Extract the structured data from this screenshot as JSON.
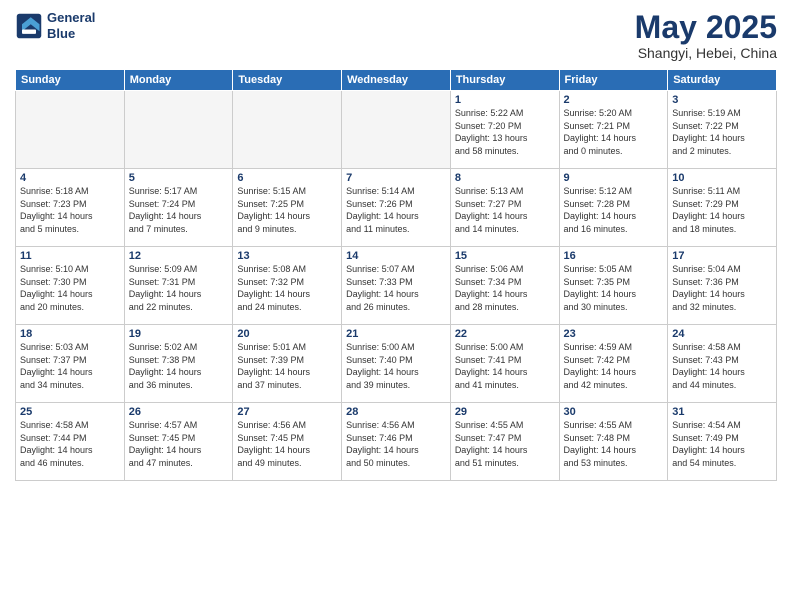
{
  "header": {
    "logo_line1": "General",
    "logo_line2": "Blue",
    "month": "May 2025",
    "location": "Shangyi, Hebei, China"
  },
  "weekdays": [
    "Sunday",
    "Monday",
    "Tuesday",
    "Wednesday",
    "Thursday",
    "Friday",
    "Saturday"
  ],
  "weeks": [
    [
      {
        "day": "",
        "info": ""
      },
      {
        "day": "",
        "info": ""
      },
      {
        "day": "",
        "info": ""
      },
      {
        "day": "",
        "info": ""
      },
      {
        "day": "1",
        "info": "Sunrise: 5:22 AM\nSunset: 7:20 PM\nDaylight: 13 hours\nand 58 minutes."
      },
      {
        "day": "2",
        "info": "Sunrise: 5:20 AM\nSunset: 7:21 PM\nDaylight: 14 hours\nand 0 minutes."
      },
      {
        "day": "3",
        "info": "Sunrise: 5:19 AM\nSunset: 7:22 PM\nDaylight: 14 hours\nand 2 minutes."
      }
    ],
    [
      {
        "day": "4",
        "info": "Sunrise: 5:18 AM\nSunset: 7:23 PM\nDaylight: 14 hours\nand 5 minutes."
      },
      {
        "day": "5",
        "info": "Sunrise: 5:17 AM\nSunset: 7:24 PM\nDaylight: 14 hours\nand 7 minutes."
      },
      {
        "day": "6",
        "info": "Sunrise: 5:15 AM\nSunset: 7:25 PM\nDaylight: 14 hours\nand 9 minutes."
      },
      {
        "day": "7",
        "info": "Sunrise: 5:14 AM\nSunset: 7:26 PM\nDaylight: 14 hours\nand 11 minutes."
      },
      {
        "day": "8",
        "info": "Sunrise: 5:13 AM\nSunset: 7:27 PM\nDaylight: 14 hours\nand 14 minutes."
      },
      {
        "day": "9",
        "info": "Sunrise: 5:12 AM\nSunset: 7:28 PM\nDaylight: 14 hours\nand 16 minutes."
      },
      {
        "day": "10",
        "info": "Sunrise: 5:11 AM\nSunset: 7:29 PM\nDaylight: 14 hours\nand 18 minutes."
      }
    ],
    [
      {
        "day": "11",
        "info": "Sunrise: 5:10 AM\nSunset: 7:30 PM\nDaylight: 14 hours\nand 20 minutes."
      },
      {
        "day": "12",
        "info": "Sunrise: 5:09 AM\nSunset: 7:31 PM\nDaylight: 14 hours\nand 22 minutes."
      },
      {
        "day": "13",
        "info": "Sunrise: 5:08 AM\nSunset: 7:32 PM\nDaylight: 14 hours\nand 24 minutes."
      },
      {
        "day": "14",
        "info": "Sunrise: 5:07 AM\nSunset: 7:33 PM\nDaylight: 14 hours\nand 26 minutes."
      },
      {
        "day": "15",
        "info": "Sunrise: 5:06 AM\nSunset: 7:34 PM\nDaylight: 14 hours\nand 28 minutes."
      },
      {
        "day": "16",
        "info": "Sunrise: 5:05 AM\nSunset: 7:35 PM\nDaylight: 14 hours\nand 30 minutes."
      },
      {
        "day": "17",
        "info": "Sunrise: 5:04 AM\nSunset: 7:36 PM\nDaylight: 14 hours\nand 32 minutes."
      }
    ],
    [
      {
        "day": "18",
        "info": "Sunrise: 5:03 AM\nSunset: 7:37 PM\nDaylight: 14 hours\nand 34 minutes."
      },
      {
        "day": "19",
        "info": "Sunrise: 5:02 AM\nSunset: 7:38 PM\nDaylight: 14 hours\nand 36 minutes."
      },
      {
        "day": "20",
        "info": "Sunrise: 5:01 AM\nSunset: 7:39 PM\nDaylight: 14 hours\nand 37 minutes."
      },
      {
        "day": "21",
        "info": "Sunrise: 5:00 AM\nSunset: 7:40 PM\nDaylight: 14 hours\nand 39 minutes."
      },
      {
        "day": "22",
        "info": "Sunrise: 5:00 AM\nSunset: 7:41 PM\nDaylight: 14 hours\nand 41 minutes."
      },
      {
        "day": "23",
        "info": "Sunrise: 4:59 AM\nSunset: 7:42 PM\nDaylight: 14 hours\nand 42 minutes."
      },
      {
        "day": "24",
        "info": "Sunrise: 4:58 AM\nSunset: 7:43 PM\nDaylight: 14 hours\nand 44 minutes."
      }
    ],
    [
      {
        "day": "25",
        "info": "Sunrise: 4:58 AM\nSunset: 7:44 PM\nDaylight: 14 hours\nand 46 minutes."
      },
      {
        "day": "26",
        "info": "Sunrise: 4:57 AM\nSunset: 7:45 PM\nDaylight: 14 hours\nand 47 minutes."
      },
      {
        "day": "27",
        "info": "Sunrise: 4:56 AM\nSunset: 7:45 PM\nDaylight: 14 hours\nand 49 minutes."
      },
      {
        "day": "28",
        "info": "Sunrise: 4:56 AM\nSunset: 7:46 PM\nDaylight: 14 hours\nand 50 minutes."
      },
      {
        "day": "29",
        "info": "Sunrise: 4:55 AM\nSunset: 7:47 PM\nDaylight: 14 hours\nand 51 minutes."
      },
      {
        "day": "30",
        "info": "Sunrise: 4:55 AM\nSunset: 7:48 PM\nDaylight: 14 hours\nand 53 minutes."
      },
      {
        "day": "31",
        "info": "Sunrise: 4:54 AM\nSunset: 7:49 PM\nDaylight: 14 hours\nand 54 minutes."
      }
    ]
  ]
}
